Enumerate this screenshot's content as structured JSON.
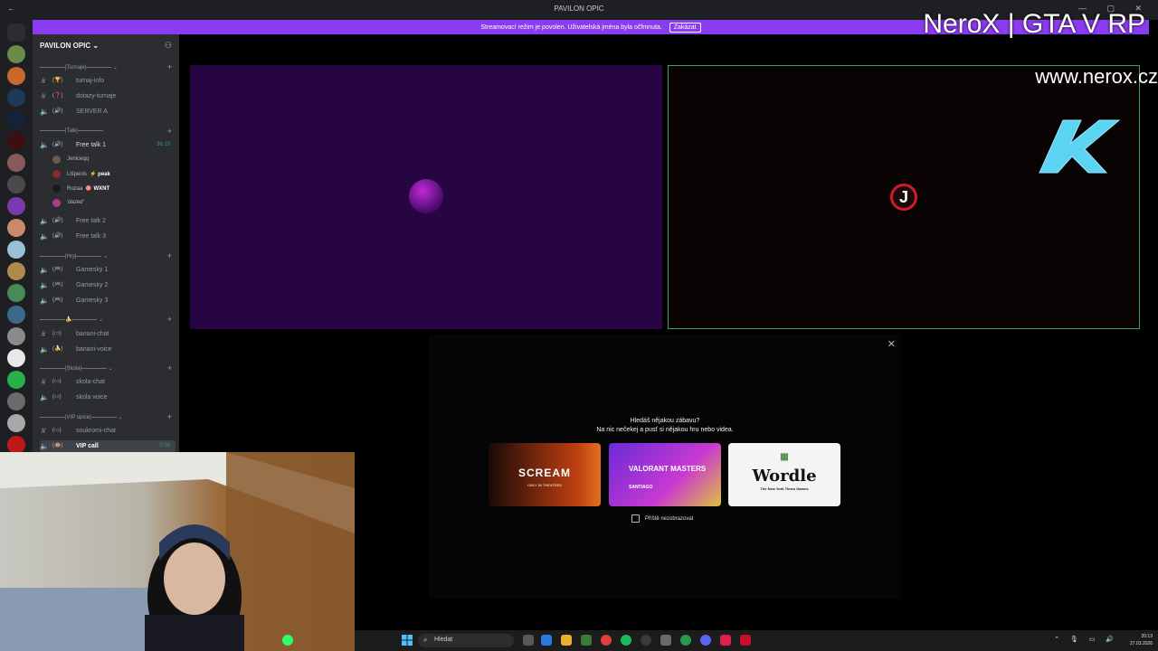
{
  "window": {
    "title": "PAVILON OPIC",
    "nav": "←",
    "controls": "— ▢ ✕"
  },
  "banner": {
    "text": "Streamovací režim je povolen. Uživatelská jména byla očfmnuta.",
    "button": "Zakázat"
  },
  "server": {
    "name": "PAVILON OPIC"
  },
  "sidebar": {
    "categories": [
      {
        "label": "|Turnaje|"
      },
      {
        "label": "|Talk|"
      },
      {
        "label": "|Hry|"
      },
      {
        "label": "🍌"
      },
      {
        "label": "|Skola|"
      },
      {
        "label": "|VIP opice|"
      }
    ],
    "channels": [
      {
        "name": "turnaj-info",
        "emoji": "(🏆)",
        "type": "text"
      },
      {
        "name": "dotazy-turnaje",
        "emoji": "(❓)",
        "type": "text"
      },
      {
        "name": "SERVER A",
        "emoji": "(🔊)",
        "type": "voice"
      },
      {
        "name": "Free talk 1",
        "emoji": "(🔊)",
        "type": "voice",
        "time": "36:19"
      },
      {
        "name": "Free talk 2",
        "emoji": "(🔊)",
        "type": "voice"
      },
      {
        "name": "Free talk 3",
        "emoji": "(🔊)",
        "type": "voice"
      },
      {
        "name": "Gamesky 1",
        "emoji": "(🎮)",
        "type": "voice"
      },
      {
        "name": "Gamesky 2",
        "emoji": "(🎮)",
        "type": "voice"
      },
      {
        "name": "Gamesky 3",
        "emoji": "(🎮)",
        "type": "voice"
      },
      {
        "name": "banani-chat",
        "emoji": "(▭)",
        "type": "text"
      },
      {
        "name": "banani-voice",
        "emoji": "(🍌)",
        "type": "voice"
      },
      {
        "name": "skola-chat",
        "emoji": "(▭)",
        "type": "text"
      },
      {
        "name": "skola voice",
        "emoji": "(▭)",
        "type": "voice"
      },
      {
        "name": "soukromi-chat",
        "emoji": "(▭)",
        "type": "text"
      },
      {
        "name": "VIP call",
        "emoji": "(🐵)",
        "type": "voice",
        "time": "0:39"
      }
    ],
    "users": [
      {
        "name": "Jeniceqq",
        "tag": ""
      },
      {
        "name": "Lišpenis",
        "tag": "⚡ peak"
      },
      {
        "name": "Ruzaa",
        "tag": "🎯 WXNT"
      },
      {
        "name": "'dazed'",
        "tag": ""
      }
    ]
  },
  "stage": {
    "right_avatar_letter": "J"
  },
  "activity": {
    "heading": "Hledáš nějakou zábavu?",
    "subheading": "Na nic nečekej a pusť si nějakou hru nebo videa.",
    "cards": [
      {
        "label": "SCREAM",
        "sub": "ONLY IN THEATERS"
      },
      {
        "label": "VALORANT MASTERS",
        "sub": "SANTIAGO"
      },
      {
        "label": "Wordle",
        "sub": "The New York Times Games"
      }
    ],
    "checkbox_label": "Příště nezobrazovat"
  },
  "overlay": {
    "title": "NeroX | GTA V RP",
    "url": "www.nerox.cz"
  },
  "taskbar": {
    "search_placeholder": "Hledat",
    "time": "20:13",
    "date": "27.03.2026"
  },
  "colors": {
    "banner": "#8c3cf0",
    "speaking_border": "#3ba55c",
    "sidebar": "#2b2d31"
  }
}
